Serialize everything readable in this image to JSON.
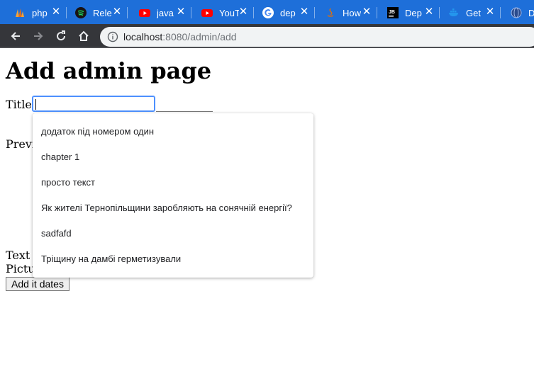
{
  "browser": {
    "tabs": [
      {
        "title": "php",
        "icon": "php-logo-icon"
      },
      {
        "title": "Rele",
        "icon": "spotify-icon"
      },
      {
        "title": "java",
        "icon": "youtube-icon"
      },
      {
        "title": "YouT",
        "icon": "youtube-icon"
      },
      {
        "title": "dep",
        "icon": "google-icon"
      },
      {
        "title": "How",
        "icon": "java-icon"
      },
      {
        "title": "Dep",
        "icon": "jetbrains-icon"
      },
      {
        "title": "Get",
        "icon": "docker-icon"
      },
      {
        "title": "De",
        "icon": "globe-icon"
      }
    ],
    "url_host": "localhost",
    "url_path": ":8080/admin/add"
  },
  "page": {
    "heading": "Add admin page",
    "title_label": "Title:",
    "title_value": "",
    "preview_label": "Previe",
    "text_label": "Text b",
    "picture_label": "Pictur",
    "submit_label": "Add it dates"
  },
  "autocomplete": {
    "items": [
      "додаток під номером один",
      "chapter 1",
      "просто текст",
      "Як жителі Тернопільщини заробляють на сонячній енергії?",
      "sadfafd",
      "Тріщину на дамбі герметизували"
    ]
  },
  "colors": {
    "tabstrip": "#1e6fd9",
    "toolbar": "#35363a",
    "omnibox": "#f1f3f4"
  }
}
